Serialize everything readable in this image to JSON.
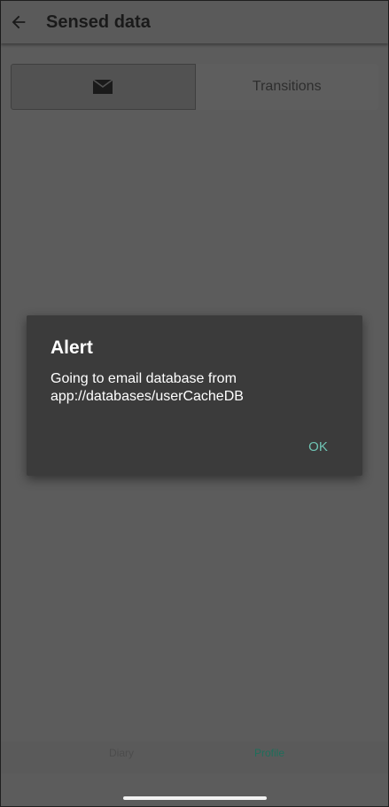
{
  "header": {
    "title": "Sensed data",
    "back_icon": "arrow-left-icon"
  },
  "segment": {
    "left_icon": "envelope-icon",
    "right_label": "Transitions",
    "selected": "left"
  },
  "dialog": {
    "title": "Alert",
    "message": "Going to email database from app://databases/userCacheDB",
    "ok_label": "OK",
    "ok_color": "#6fc4b4"
  },
  "bottom_nav": {
    "items": [
      {
        "label": "Diary",
        "active": false
      },
      {
        "label": "Profile",
        "active": true
      }
    ],
    "active_color": "#1e6e5b"
  },
  "colors": {
    "overlay_background": "#5c5c5c",
    "dialog_background": "#3b3b3b"
  }
}
